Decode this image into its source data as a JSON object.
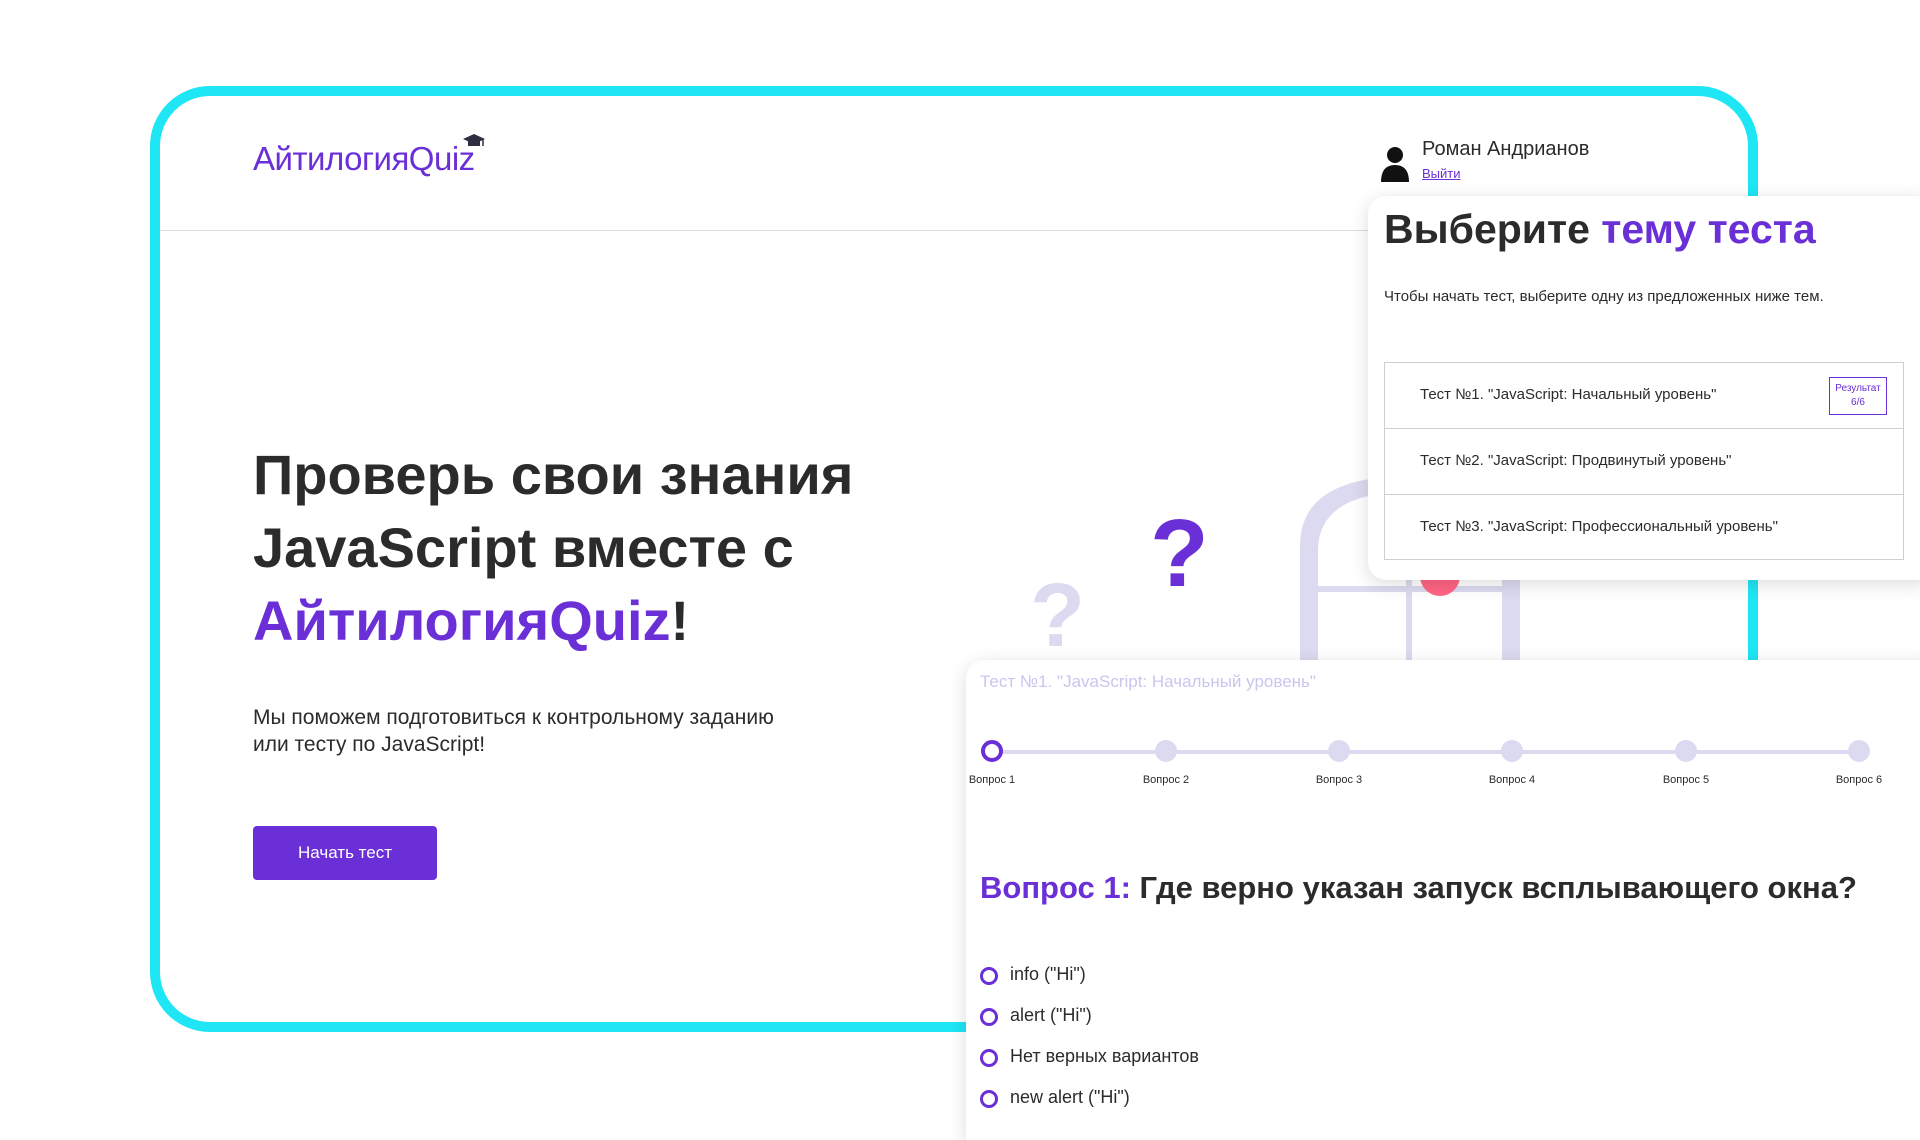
{
  "header": {
    "logo": "АйтилогияQuiz",
    "user_name": "Роман Андрианов",
    "logout": "Выйти"
  },
  "hero": {
    "title_line1": "Проверь свои знания",
    "title_line2": "JavaScript вместе с",
    "title_accent": "АйтилогияQuiz",
    "title_end": "!",
    "subtitle": "Мы поможем подготовиться к контрольному заданию или тесту по JavaScript!",
    "start_button": "Начать тест"
  },
  "topics": {
    "title_plain": "Выберите ",
    "title_accent": "тему теста",
    "description": "Чтобы начать тест, выберите одну из предложенных ниже тем.",
    "tests": [
      {
        "label": "Тест №1. \"JavaScript: Начальный уровень\"",
        "result_label": "Результат",
        "result_value": "6/6"
      },
      {
        "label": "Тест №2. \"JavaScript: Продвинутый уровень\""
      },
      {
        "label": "Тест №3. \"JavaScript: Профессиональный уровень\""
      }
    ]
  },
  "quiz": {
    "test_title": "Тест №1. \"JavaScript: Начальный уровень\"",
    "steps": [
      "Вопрос 1",
      "Вопрос 2",
      "Вопрос 3",
      "Вопрос 4",
      "Вопрос 5",
      "Вопрос 6"
    ],
    "active_step": 1,
    "question_number": "Вопрос 1:",
    "question_text": " Где верно указан запуск всплывающего окна?",
    "answers": [
      "info (\"Hi\")",
      "alert (\"Hi\")",
      "Нет верных вариантов",
      "new alert (\"Hi\")"
    ]
  },
  "colors": {
    "accent": "#6a2fd6",
    "frame": "#1ee6f4",
    "illustration_light": "#dcdaf0",
    "illustration_dark": "#2f2e41",
    "sun": "#ff6584"
  }
}
